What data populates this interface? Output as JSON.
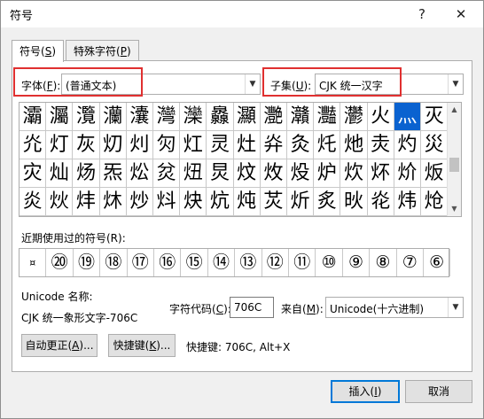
{
  "window": {
    "title": "符号",
    "help_label": "?",
    "close_label": "✕"
  },
  "tabs": [
    {
      "label_text": "符号(",
      "hotkey": "S",
      "label_end": ")"
    },
    {
      "label_text": "特殊字符(",
      "hotkey": "P",
      "label_end": ")"
    }
  ],
  "font": {
    "label_text": "字体(",
    "hotkey": "F",
    "label_end": "):",
    "value": "(普通文本)"
  },
  "subset": {
    "label_text": "子集(",
    "hotkey": "U",
    "label_end": "):",
    "value": "CJK 统一汉字"
  },
  "grid": {
    "rows": [
      [
        "灞",
        "灟",
        "灠",
        "灡",
        "灢",
        "灣",
        "灤",
        "灥",
        "灦",
        "灧",
        "灨",
        "灩",
        "灪",
        "火",
        "灬",
        "灭"
      ],
      [
        "灮",
        "灯",
        "灰",
        "灱",
        "灲",
        "灳",
        "灴",
        "灵",
        "灶",
        "灷",
        "灸",
        "灹",
        "灺",
        "灻",
        "灼",
        "災"
      ],
      [
        "灾",
        "灿",
        "炀",
        "炁",
        "炂",
        "炃",
        "炄",
        "炅",
        "炆",
        "炇",
        "炈",
        "炉",
        "炊",
        "炋",
        "炌",
        "炍"
      ],
      [
        "炎",
        "炏",
        "炐",
        "炑",
        "炒",
        "炓",
        "炔",
        "炕",
        "炖",
        "炗",
        "炘",
        "炙",
        "炚",
        "炛",
        "炜",
        "炝"
      ]
    ],
    "selected_char": "灬"
  },
  "recent": {
    "label": "近期使用过的符号(R):",
    "symbols": [
      "¤",
      "⑳",
      "⑲",
      "⑱",
      "⑰",
      "⑯",
      "⑮",
      "⑭",
      "⑬",
      "⑫",
      "⑪",
      "⑩",
      "⑨",
      "⑧",
      "⑦",
      "⑥"
    ]
  },
  "info": {
    "unicode_name_label": "Unicode 名称:",
    "unicode_name": "CJK 统一象形文字-706C",
    "code_label_text": "字符代码(",
    "code_hotkey": "C",
    "code_label_end": "):",
    "code_value": "706C",
    "from_label_text": "来自(",
    "from_hotkey": "M",
    "from_label_end": "):",
    "from_value": "Unicode(十六进制)"
  },
  "buttons": {
    "autocorrect_text": "自动更正(",
    "autocorrect_hotkey": "A",
    "autocorrect_end": ")...",
    "shortcut_text": "快捷键(",
    "shortcut_hotkey": "K",
    "shortcut_end": ")...",
    "shortcut_info": "快捷键: 706C, Alt+X",
    "insert_text": "插入(",
    "insert_hotkey": "I",
    "insert_end": ")",
    "cancel": "取消"
  },
  "colors": {
    "highlight": "#e03030",
    "selection": "#0a62d0"
  }
}
